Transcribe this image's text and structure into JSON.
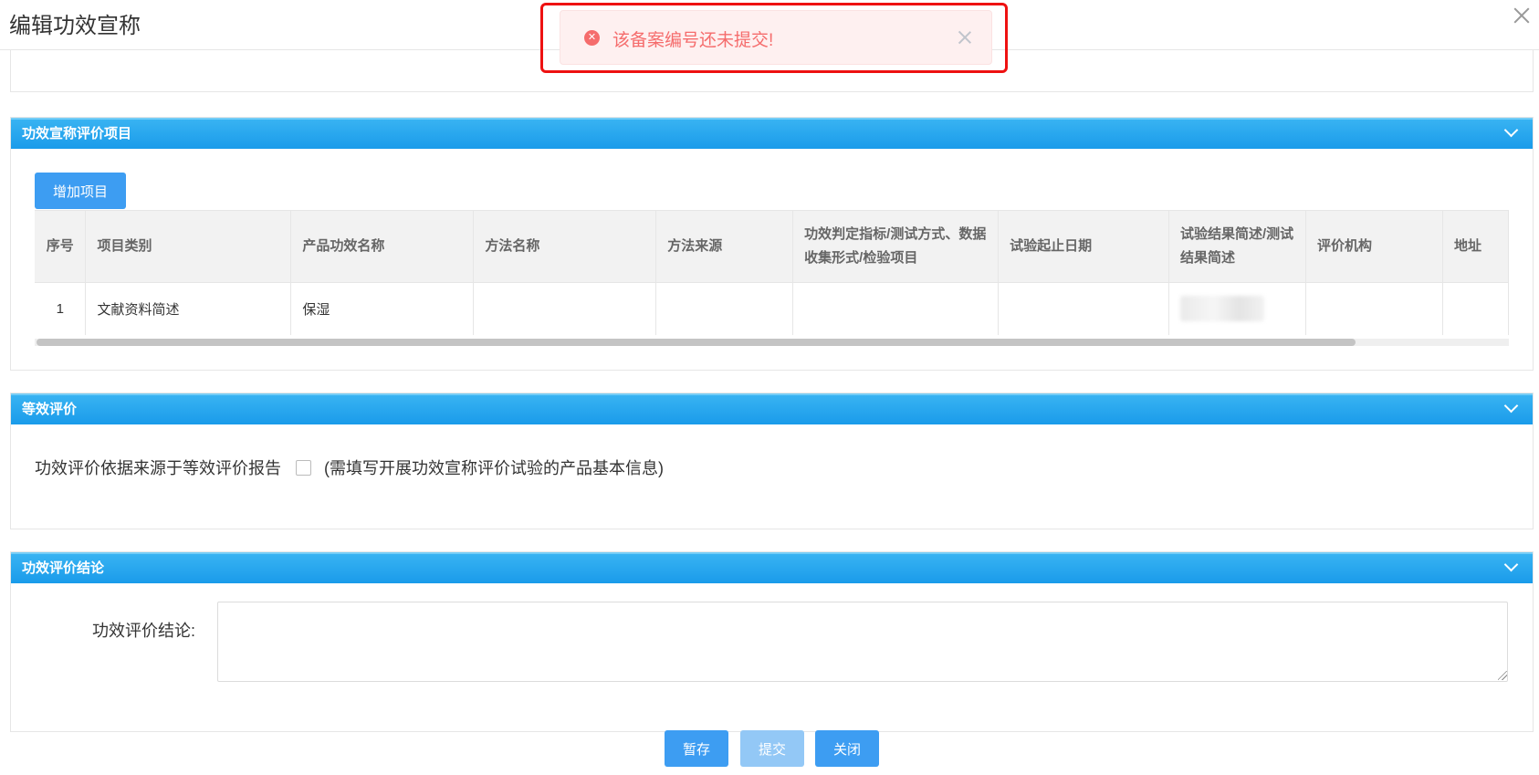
{
  "dialog": {
    "title": "编辑功效宣称"
  },
  "toast": {
    "message": "该备案编号还未提交!",
    "type": "error"
  },
  "sections": {
    "evaluation_items": {
      "title": "功效宣称评价项目",
      "add_button": "增加项目",
      "columns": [
        "序号",
        "项目类别",
        "产品功效名称",
        "方法名称",
        "方法来源",
        "功效判定指标/测试方式、数据收集形式/检验项目",
        "试验起止日期",
        "试验结果简述/测试结果简述",
        "评价机构",
        "地址"
      ],
      "rows": [
        {
          "index": "1",
          "category": "文献资料简述",
          "efficacy_name": "保湿",
          "method_name": "",
          "method_source": "",
          "indicator": "",
          "dates": "",
          "result": "",
          "institution": "",
          "address": ""
        }
      ]
    },
    "equivalent": {
      "title": "等效评价",
      "checkbox_label": "功效评价依据来源于等效评价报告",
      "checked": false,
      "hint": "(需填写开展功效宣称评价试验的产品基本信息)"
    },
    "conclusion": {
      "title": "功效评价结论",
      "label": "功效评价结论:",
      "value": ""
    }
  },
  "footer": {
    "save_draft": "暂存",
    "submit": "提交",
    "close": "关闭"
  },
  "colors": {
    "header_blue": "#1a9bea",
    "button_blue": "#3d9df2",
    "button_disabled": "#93c8f6",
    "error_red": "#f56c6c"
  }
}
